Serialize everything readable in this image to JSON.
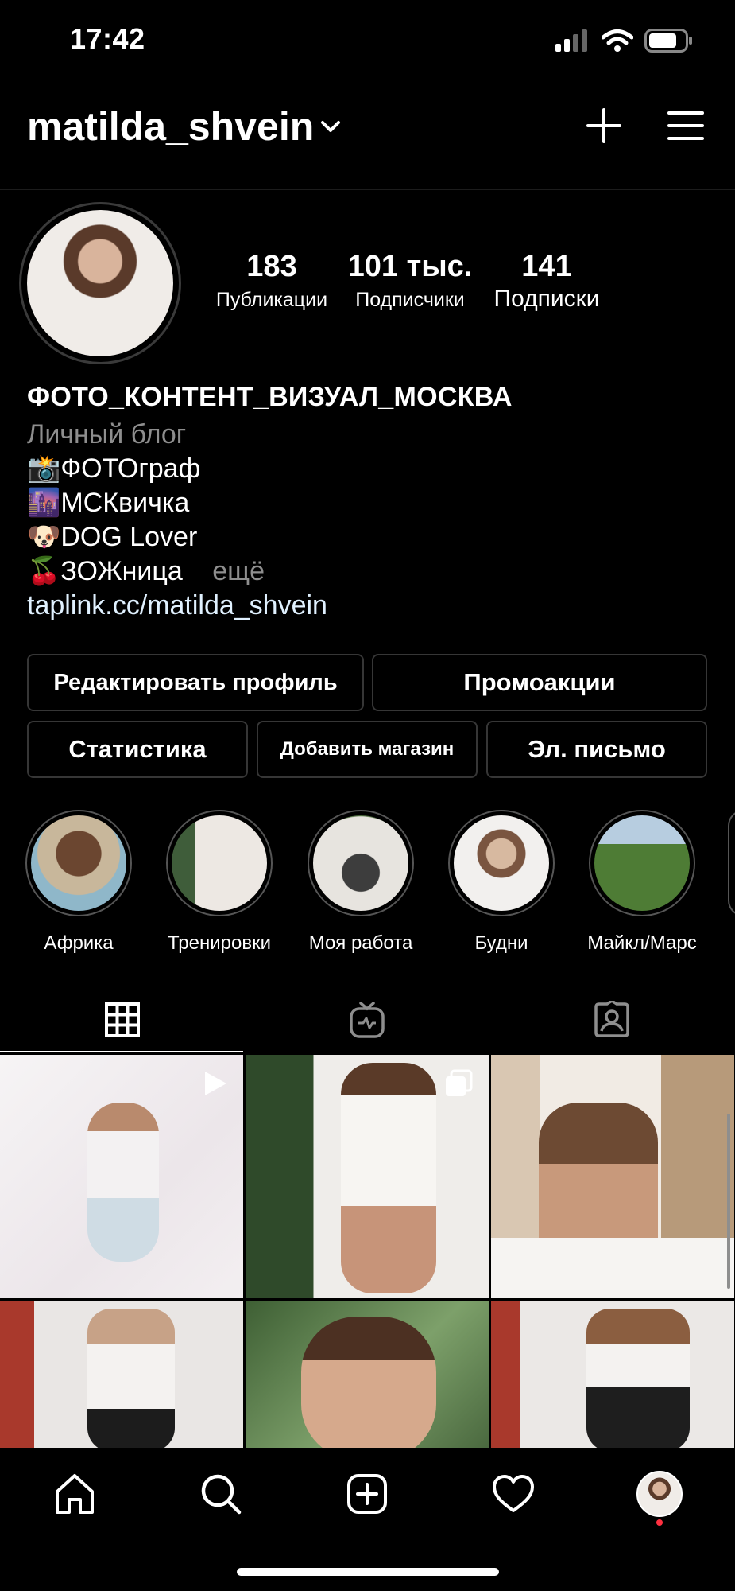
{
  "status_bar": {
    "time": "17:42"
  },
  "header": {
    "username": "matilda_shvein"
  },
  "stats": [
    {
      "value": "183",
      "label": "Публикации"
    },
    {
      "value": "101 тыс.",
      "label": "Подписчики"
    },
    {
      "value": "141",
      "label": "Подписки"
    }
  ],
  "bio": {
    "name": "ФОТО_КОНТЕНТ_ВИЗУАЛ_МОСКВА",
    "category": "Личный блог",
    "lines": [
      "📸ФОТОграф",
      "🌆МСКвичка",
      "🐶DOG Lover",
      "🍒ЗОЖница"
    ],
    "more": "ещё",
    "link": "taplink.cc/matilda_shvein"
  },
  "buttons": {
    "edit_profile": "Редактировать профиль",
    "promotions": "Промоакции",
    "statistics": "Статистика",
    "add_shop": "Добавить магазин",
    "email": "Эл. письмо"
  },
  "highlights": [
    {
      "label": "Африка"
    },
    {
      "label": "Тренировки"
    },
    {
      "label": "Моя работа"
    },
    {
      "label": "Будни"
    },
    {
      "label": "Майкл/Марс"
    }
  ],
  "colors": {
    "background": "#000000",
    "muted": "#8e8e8e",
    "link": "#e0f1ff",
    "notification_dot": "#ff3040"
  }
}
